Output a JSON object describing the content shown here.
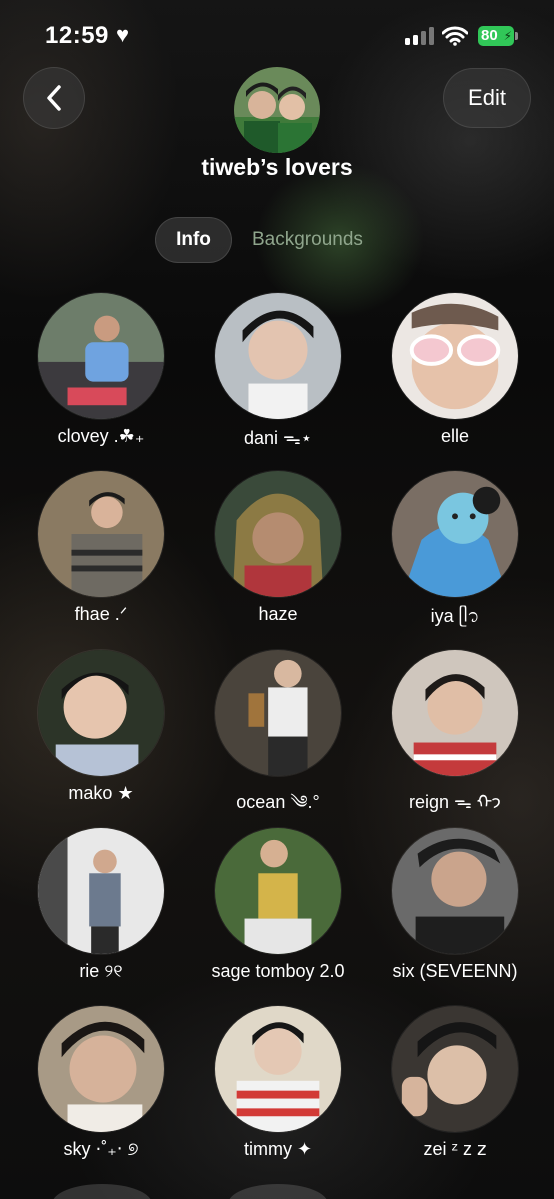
{
  "status_bar": {
    "time": "12:59",
    "heart_icon": "heart-icon",
    "battery": "80"
  },
  "header": {
    "back_icon": "chevron-left-icon",
    "edit_label": "Edit",
    "group_name": "tiweb’s lovers"
  },
  "tabs": [
    {
      "label": "Info",
      "selected": true
    },
    {
      "label": "Backgrounds",
      "selected": false
    }
  ],
  "colors": {
    "battery_green": "#31c758",
    "inactive_tab": "#8fa58c"
  },
  "members": [
    {
      "name": "clovey .☘︎₊"
    },
    {
      "name": "dani ᯓ⋆"
    },
    {
      "name": "elle"
    },
    {
      "name": "fhae .ᐟ"
    },
    {
      "name": "haze"
    },
    {
      "name": "iya ᥫ᭡"
    },
    {
      "name": "mako ★"
    },
    {
      "name": "ocean ༄.°"
    },
    {
      "name": "reign ᯓ ᡣ𐭩"
    },
    {
      "name": "rie ୨୧"
    },
    {
      "name": "sage tomboy 2.0"
    },
    {
      "name": "six (SEVEENN)"
    },
    {
      "name": "sky ⋅˚₊‧ ୭"
    },
    {
      "name": "timmy ✦"
    },
    {
      "name": "zei ᶻ z 𝗓"
    }
  ]
}
